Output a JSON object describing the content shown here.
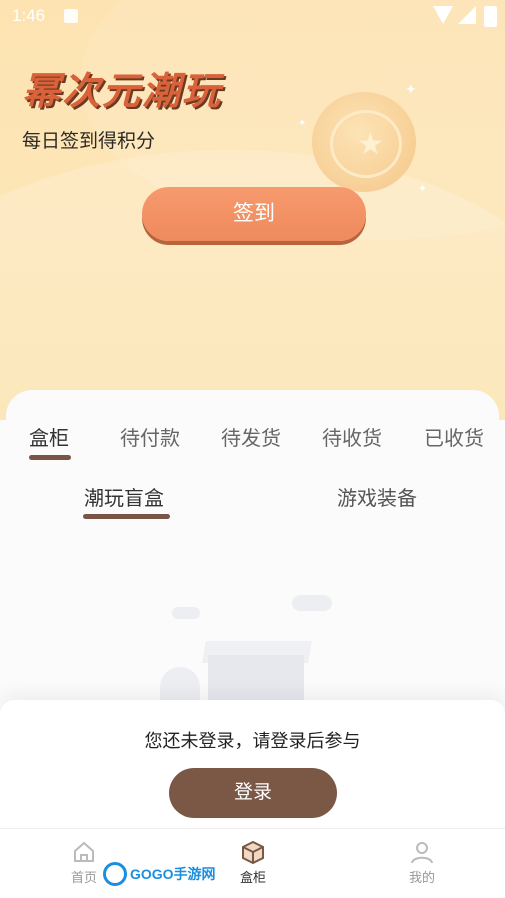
{
  "status_bar": {
    "time": "1:46"
  },
  "header": {
    "title": "幂次元潮玩",
    "subtitle": "每日签到得积分",
    "sign_in_label": "签到"
  },
  "order_tabs": [
    {
      "label": "盒柜",
      "active": true
    },
    {
      "label": "待付款",
      "active": false
    },
    {
      "label": "待发货",
      "active": false
    },
    {
      "label": "待收货",
      "active": false
    },
    {
      "label": "已收货",
      "active": false
    }
  ],
  "sub_tabs": [
    {
      "label": "潮玩盲盒",
      "active": true
    },
    {
      "label": "游戏装备",
      "active": false
    }
  ],
  "login_prompt": {
    "message": "您还未登录，请登录后参与",
    "button_label": "登录"
  },
  "bottom_nav": [
    {
      "label": "首页",
      "icon": "home-icon",
      "active": false
    },
    {
      "label": "盒柜",
      "icon": "box-icon",
      "active": true
    },
    {
      "label": "我的",
      "icon": "user-icon",
      "active": false
    }
  ],
  "watermark": {
    "text": "GOGO手游网"
  },
  "colors": {
    "accent": "#ef8a5c",
    "brown": "#7b5746",
    "hero_bg": "#fde3b2"
  }
}
